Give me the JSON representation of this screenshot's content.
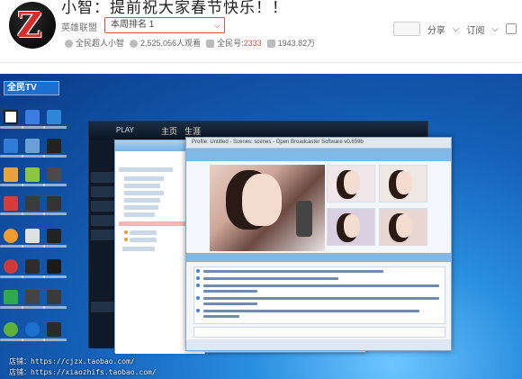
{
  "header": {
    "title": "小智：提前祝大家春节快乐！！",
    "category": "英雄联盟",
    "rank_label": "本周排名 1",
    "streamer": "全民超人小智",
    "viewers": "2,525,056人观看",
    "id_label": "全民号:",
    "id_value": "2333",
    "fans": "1943.82万",
    "share_label": "分享",
    "more_label": "订阅"
  },
  "obs": {
    "title": "Profile: Untitled - Scenes: scenes - Open Broadcaster Software v0.659b"
  },
  "watermarks": [
    "店铺：https://cjzx.taobao.com/",
    "店铺：https://xiaozhifs.taobao.com/"
  ],
  "colors": {
    "accent": "#e34c3f",
    "desktop_blue": "#1460b8"
  }
}
